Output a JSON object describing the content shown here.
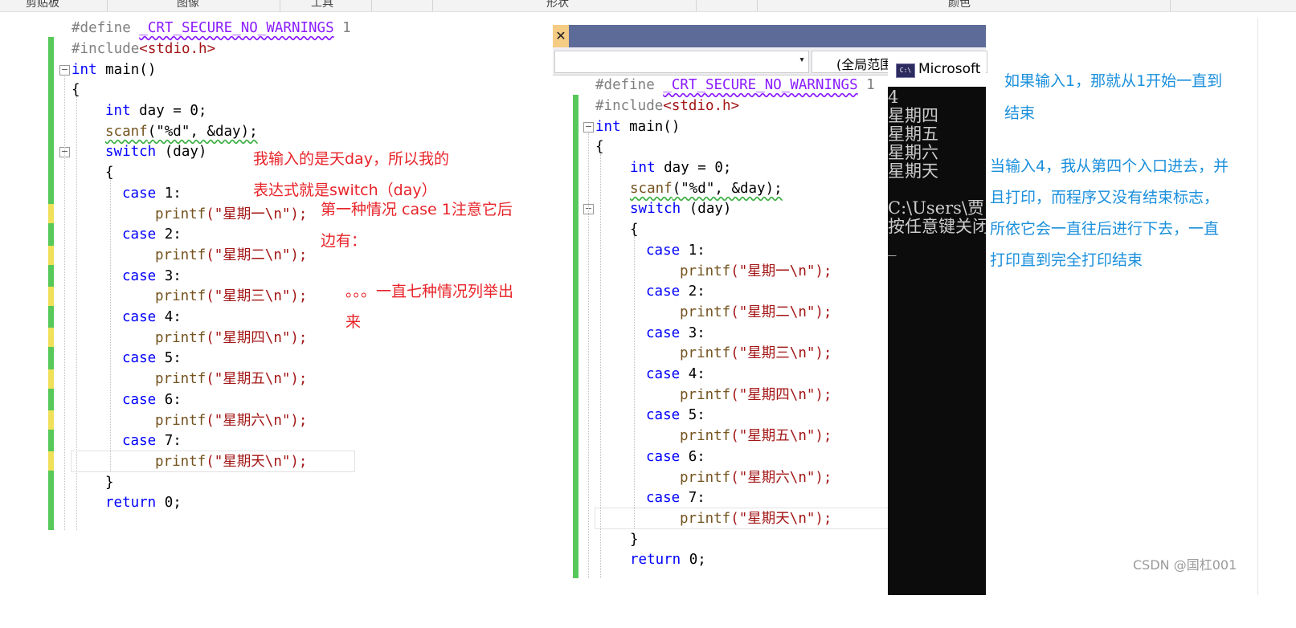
{
  "ribbon": {
    "groups": [
      "剪贴板",
      "图像",
      "工具",
      "形状",
      "颜色"
    ]
  },
  "left_editor": {
    "lines": [
      {
        "pre": "#define ",
        "macro": "_CRT_SECURE_NO_WARNINGS",
        "val": " 1"
      },
      {
        "pre": "#include",
        "hdr": "<stdio.h>"
      },
      {
        "t": "int",
        "r": " main()"
      },
      {
        "r": "{"
      },
      {
        "t": "int",
        "r": " day = 0;"
      },
      {
        "fn": "scanf",
        "s": "(\"%d\", &day);"
      },
      {
        "kw": "switch",
        "r": " (day)"
      },
      {
        "r": "{"
      },
      {
        "kw": "case",
        "r": " 1:"
      },
      {
        "fn": "printf",
        "s": "(\"星期一\\n\");"
      },
      {
        "kw": "case",
        "r": " 2:"
      },
      {
        "fn": "printf",
        "s": "(\"星期二\\n\");"
      },
      {
        "kw": "case",
        "r": " 3:"
      },
      {
        "fn": "printf",
        "s": "(\"星期三\\n\");"
      },
      {
        "kw": "case",
        "r": " 4:"
      },
      {
        "fn": "printf",
        "s": "(\"星期四\\n\");"
      },
      {
        "kw": "case",
        "r": " 5:"
      },
      {
        "fn": "printf",
        "s": "(\"星期五\\n\");"
      },
      {
        "kw": "case",
        "r": " 6:"
      },
      {
        "fn": "printf",
        "s": "(\"星期六\\n\");"
      },
      {
        "kw": "case",
        "r": " 7:"
      },
      {
        "fn": "printf",
        "s": "(\"星期天\\n\");"
      },
      {
        "r": "}"
      },
      {
        "kw": "return",
        "r": " 0;"
      }
    ]
  },
  "left_notes": {
    "n1": "我输入的是天day，所以我的",
    "n2": "表达式就是switch（day）",
    "n3": "第一种情况 case 1注意它后",
    "n4": "边有：",
    "n5": "。。。一直七种情况列举出",
    "n6": "来"
  },
  "right_window": {
    "close_glyph": "✕",
    "scope_dropdown": "",
    "scope_label": "(全局范围)",
    "dropdown_arrow": "▾"
  },
  "console": {
    "title": "Microsoft",
    "icon_text": "C:\\",
    "lines": [
      "4",
      "星期四",
      "星期五",
      "星期六",
      "星期天",
      "",
      "C:\\Users\\贾",
      "按任意键关闭",
      "_"
    ]
  },
  "right_notes": {
    "n1": "如果输入1，那就从1开始一直到",
    "n2": "结束",
    "n3": "当输入4，我从第四个入口进去，并",
    "n4": "且打印，而程序又没有结束标志，",
    "n5": "所依它会一直往后进行下去，一直",
    "n6": "打印直到完全打印结束"
  },
  "watermark": "CSDN @国杠001",
  "colors": {
    "note_red": "#e8242a",
    "note_blue": "#1a8fdc",
    "change_green": "#57c95a",
    "change_yellow": "#f0e05a",
    "keyword": "#0000ff",
    "string": "#a31515"
  }
}
